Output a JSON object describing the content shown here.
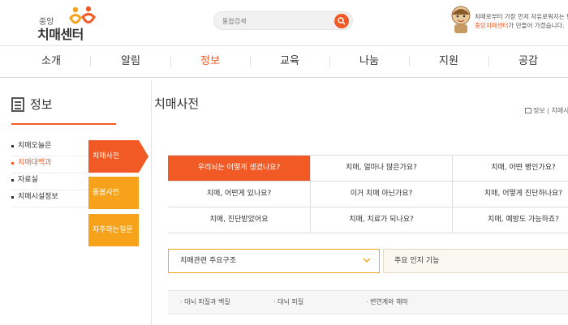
{
  "logo": {
    "small": "중앙",
    "big": "치매센터"
  },
  "search": {
    "placeholder": "통합검색"
  },
  "promo": {
    "line1": "치매로부터 가장 먼저 자유로워지는 !",
    "line2_highlight": "중앙치매센터",
    "line2_rest": "가 만들어 가겠습니다."
  },
  "gnb": {
    "items": [
      {
        "label": "소개"
      },
      {
        "label": "알림"
      },
      {
        "label": "정보"
      },
      {
        "label": "교육"
      },
      {
        "label": "나눔"
      },
      {
        "label": "지원"
      },
      {
        "label": "공감"
      }
    ],
    "active_index": 2
  },
  "lnb": {
    "title": "정보",
    "items": [
      {
        "label": "치매오늘은"
      },
      {
        "label": "치매대백과"
      },
      {
        "label": "자료실"
      },
      {
        "label": "치매시설정보"
      }
    ],
    "active_index": 1,
    "sub_tabs": [
      {
        "label": "치매사전"
      },
      {
        "label": "돌봄사전"
      },
      {
        "label": "자주하는질문"
      }
    ]
  },
  "main": {
    "title": "치매사전",
    "breadcrumb": {
      "level1": "정보",
      "sep": "|",
      "level2": "치매사"
    },
    "questions": [
      [
        "우리뇌는 어떻게 생겼나요?",
        "치매, 얼마나 많은가요?",
        "치매, 어떤 병인가요?"
      ],
      [
        "치매, 어떤게 있나요?",
        "이거 치매 아닌가요?",
        "치매, 어떻게 진단하나요?"
      ],
      [
        "치매, 진단받았어요",
        "치매, 치료가 되나요?",
        "치매, 예방도 가능하죠?"
      ]
    ],
    "select1": {
      "value": "치매관련 주요구조"
    },
    "select2": {
      "value": "주요 인지 기능"
    },
    "sublist": [
      "· 대뇌 피질과 백질",
      "· 대뇌 피질",
      "· 변연계와 해마"
    ]
  },
  "colors": {
    "accent": "#f15a24",
    "secondary": "#f6a21b"
  }
}
